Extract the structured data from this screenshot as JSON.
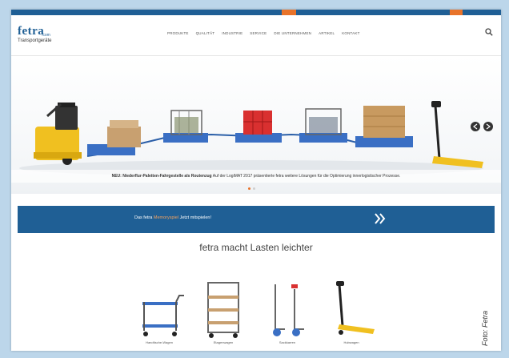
{
  "header": {
    "brand": "fetra",
    "brand_sub": ".com",
    "tagline": "Transportgeräte"
  },
  "nav": {
    "items": [
      "PRODUKTE",
      "QUALITÄT",
      "INDUSTRIE",
      "SERVICE",
      "DIE UNTERNEHMEN",
      "ARTIKEL",
      "KONTAKT"
    ]
  },
  "hero": {
    "caption_bold": "NEU: Niederflur-Paletten-Fahrgestelle als Routenzug",
    "caption_rest": "Auf der LogiMAT 2017 präsentierte fetra weitere Lösungen für die Optimierung innerlogistischer Prozesse.",
    "slide_count": 2,
    "active_slide": 1
  },
  "banner": {
    "text_before": "Das fetra",
    "text_highlight": "Memoryspiel",
    "text_after": "Jetzt mitspielen!"
  },
  "slogan": "fetra macht Lasten leichter",
  "products": [
    {
      "label": "Handtische-Wagen"
    },
    {
      "label": "Etagenwagen"
    },
    {
      "label": "Sackkarren"
    },
    {
      "label": "Hubwagen"
    }
  ],
  "credit": "Foto: Fetra",
  "colors": {
    "brand_blue": "#1f5f95",
    "accent_orange": "#e8732a",
    "background_blue": "#bcd6ea"
  }
}
